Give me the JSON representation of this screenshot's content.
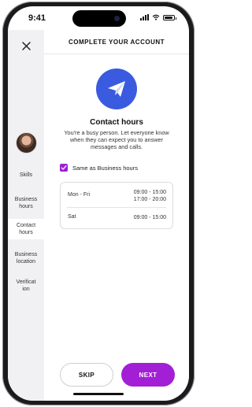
{
  "status_bar": {
    "time": "9:41"
  },
  "sidebar": {
    "items": [
      {
        "label": "Skills"
      },
      {
        "label": "Business hours"
      },
      {
        "label": "Contact hours",
        "active": true
      },
      {
        "label": "Business location"
      },
      {
        "label": "Verificat ion"
      }
    ]
  },
  "header": {
    "title": "COMPLETE YOUR ACCOUNT"
  },
  "main": {
    "icon": "paper-plane-icon",
    "title": "Contact hours",
    "subtitle": "You're a busy person. Let everyone know when they can expect you to answer messages and calls.",
    "checkbox": {
      "label": "Same as Business hours",
      "checked": true
    },
    "hours": [
      {
        "day": "Mon - Fri",
        "line1": "09:00 - 15:00",
        "line2": "17:00 - 20:00"
      },
      {
        "day": "Sat",
        "line1": "09:00 - 15:00",
        "line2": ""
      }
    ]
  },
  "footer": {
    "skip_label": "SKIP",
    "next_label": "NEXT"
  },
  "colors": {
    "accent": "#a21fd6",
    "icon_bg": "#3a5be0",
    "sidebar_bg": "#f1f1f3"
  }
}
